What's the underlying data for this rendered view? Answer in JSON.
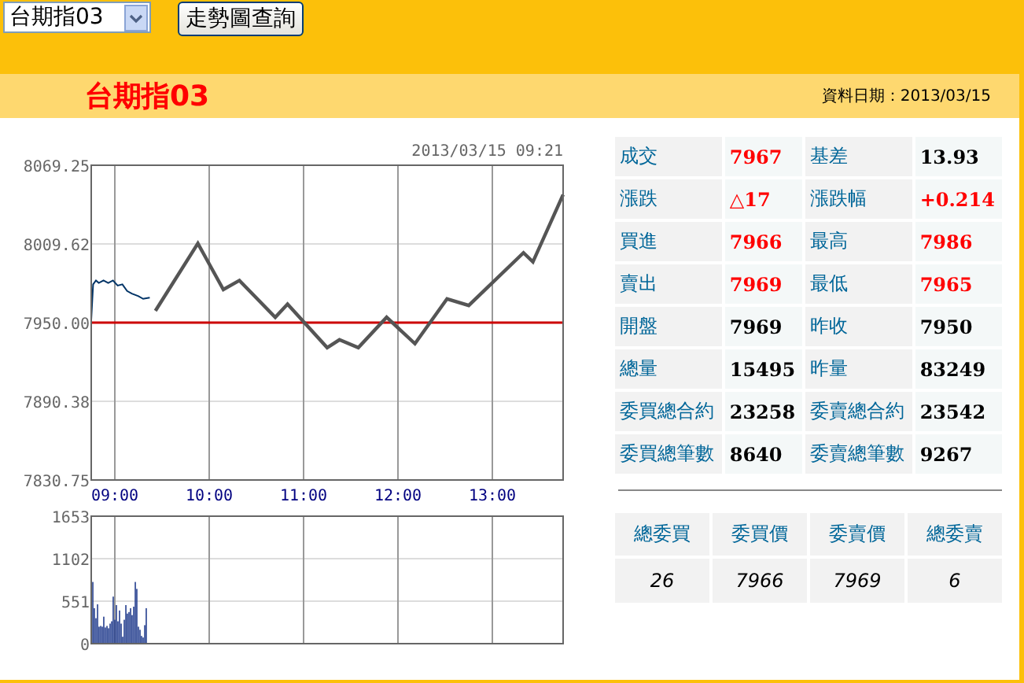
{
  "toolbar": {
    "contract_select": {
      "value": "台期指03"
    },
    "query_button": "走勢圖查詢"
  },
  "header": {
    "title": "台期指03",
    "date_label": "資料日期：2013/03/15"
  },
  "price_chart": {
    "timestamp": "2013/03/15 09:21",
    "chart_data": {
      "type": "line",
      "xlim": [
        8.75,
        13.75
      ],
      "ylim": [
        7830.75,
        8069.25
      ],
      "xticks": [
        {
          "value": 9,
          "label": "09:00"
        },
        {
          "value": 10,
          "label": "10:00"
        },
        {
          "value": 11,
          "label": "11:00"
        },
        {
          "value": 12,
          "label": "12:00"
        },
        {
          "value": 13,
          "label": "13:00"
        }
      ],
      "yticks": [
        {
          "value": 8069.25,
          "label": "8069.25"
        },
        {
          "value": 8009.62,
          "label": "8009.62"
        },
        {
          "value": 7950,
          "label": "7950.00"
        },
        {
          "value": 7890.38,
          "label": "7890.38"
        },
        {
          "value": 7830.75,
          "label": "7830.75"
        }
      ],
      "ref_lines": [
        {
          "axis": "y",
          "value": 7950,
          "color": "#cc0000"
        }
      ],
      "grid": true,
      "series": [
        {
          "color": "#555555",
          "x": [
            9.43,
            9.88,
            10.15,
            10.32,
            10.7,
            10.83,
            11.25,
            11.38,
            11.58,
            11.88,
            12.18,
            12.52,
            12.75,
            13.33,
            13.43,
            13.75
          ],
          "values": [
            7959,
            8010,
            7975,
            7982,
            7954,
            7964,
            7931,
            7937,
            7931,
            7954,
            7934,
            7968,
            7963,
            8003,
            7996,
            8047
          ]
        },
        {
          "color": "#003366",
          "x": [
            8.75,
            8.77,
            8.8,
            8.83,
            8.88,
            8.93,
            8.98,
            9.03,
            9.08,
            9.13,
            9.18,
            9.25,
            9.3,
            9.37
          ],
          "values": [
            7952,
            7979,
            7982,
            7980,
            7982,
            7980,
            7982,
            7978,
            7979,
            7974,
            7972,
            7970,
            7968,
            7969
          ]
        }
      ]
    }
  },
  "volume_chart": {
    "chart_data": {
      "type": "bar",
      "grid": true,
      "xlim": [
        8.75,
        13.75
      ],
      "ylim": [
        0,
        1653
      ],
      "yticks": [
        0,
        551,
        1102,
        1653
      ],
      "x": [
        8.767,
        8.783,
        8.8,
        8.817,
        8.833,
        8.85,
        8.867,
        8.883,
        8.9,
        8.917,
        8.933,
        8.95,
        8.967,
        8.983,
        9,
        9.017,
        9.033,
        9.05,
        9.067,
        9.083,
        9.1,
        9.117,
        9.133,
        9.15,
        9.167,
        9.183,
        9.2,
        9.217,
        9.233,
        9.25,
        9.267,
        9.283,
        9.3,
        9.317,
        9.333
      ],
      "series": [
        {
          "color": "#253f8f",
          "values": [
            800,
            460,
            330,
            510,
            220,
            230,
            220,
            350,
            210,
            230,
            200,
            260,
            290,
            610,
            310,
            500,
            290,
            430,
            260,
            90,
            310,
            500,
            390,
            410,
            460,
            370,
            480,
            800,
            710,
            220,
            180,
            100,
            80,
            240,
            460
          ]
        }
      ]
    }
  },
  "quote_table": {
    "rows": [
      [
        {
          "label": "成交",
          "value": "7967",
          "color": "#ff0000"
        },
        {
          "label": "基差",
          "value": "13.93",
          "color": "#000000"
        }
      ],
      [
        {
          "label": "漲跌",
          "value": "△17",
          "color": "#ff0000"
        },
        {
          "label": "漲跌幅",
          "value": "+0.214",
          "color": "#ff0000"
        }
      ],
      [
        {
          "label": "買進",
          "value": "7966",
          "color": "#ff0000"
        },
        {
          "label": "最高",
          "value": "7986",
          "color": "#ff0000"
        }
      ],
      [
        {
          "label": "賣出",
          "value": "7969",
          "color": "#ff0000"
        },
        {
          "label": "最低",
          "value": "7965",
          "color": "#ff0000"
        }
      ],
      [
        {
          "label": "開盤",
          "value": "7969",
          "color": "#000000"
        },
        {
          "label": "昨收",
          "value": "7950",
          "color": "#000000"
        }
      ],
      [
        {
          "label": "總量",
          "value": "15495",
          "color": "#000000"
        },
        {
          "label": "昨量",
          "value": "83249",
          "color": "#000000"
        }
      ],
      [
        {
          "label": "委買總合約",
          "value": "23258",
          "color": "#000000"
        },
        {
          "label": "委賣總合約",
          "value": "23542",
          "color": "#000000"
        }
      ],
      [
        {
          "label": "委買總筆數",
          "value": "8640",
          "color": "#000000"
        },
        {
          "label": "委賣總筆數",
          "value": "9267",
          "color": "#000000"
        }
      ]
    ]
  },
  "order_table": {
    "columns": [
      "總委買",
      "委買價",
      "委賣價",
      "總委賣"
    ],
    "values": [
      "26",
      "7966",
      "7969",
      "6"
    ]
  }
}
